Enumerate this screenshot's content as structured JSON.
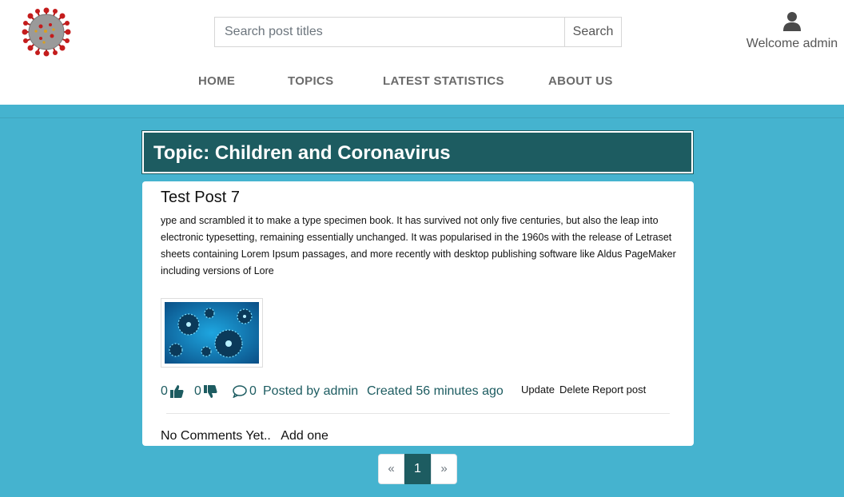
{
  "header": {
    "logo_icon": "coronavirus-logo",
    "search": {
      "placeholder": "Search post titles",
      "button_label": "Search"
    },
    "user": {
      "icon": "user-icon",
      "welcome_text": "Welcome admin"
    }
  },
  "nav": {
    "items": [
      {
        "label": "HOME"
      },
      {
        "label": "TOPICS"
      },
      {
        "label": "LATEST STATISTICS"
      },
      {
        "label": "ABOUT US"
      }
    ]
  },
  "topic": {
    "title": "Topic: Children and Coronavirus"
  },
  "post": {
    "title": "Test Post 7",
    "body": "ype and scrambled it to make a type specimen book. It has survived not only five centuries, but also the leap into electronic typesetting, remaining essentially unchanged. It was popularised in the 1960s with the release of Letraset sheets containing Lorem Ipsum passages, and more recently with desktop publishing software like Aldus PageMaker including versions of Lore",
    "image_icon": "virus-image",
    "likes": "0",
    "dislikes": "0",
    "comment_count": "0",
    "posted_by": "Posted by admin",
    "created": "Created 56 minutes ago",
    "actions": {
      "update": "Update",
      "delete": "Delete",
      "report": "Report post"
    },
    "no_comments": "No Comments Yet..",
    "add_one": "Add one"
  },
  "pagination": {
    "prev": "«",
    "current": "1",
    "next": "»"
  },
  "colors": {
    "accent": "#1d5c61",
    "background": "#45b3cf"
  }
}
